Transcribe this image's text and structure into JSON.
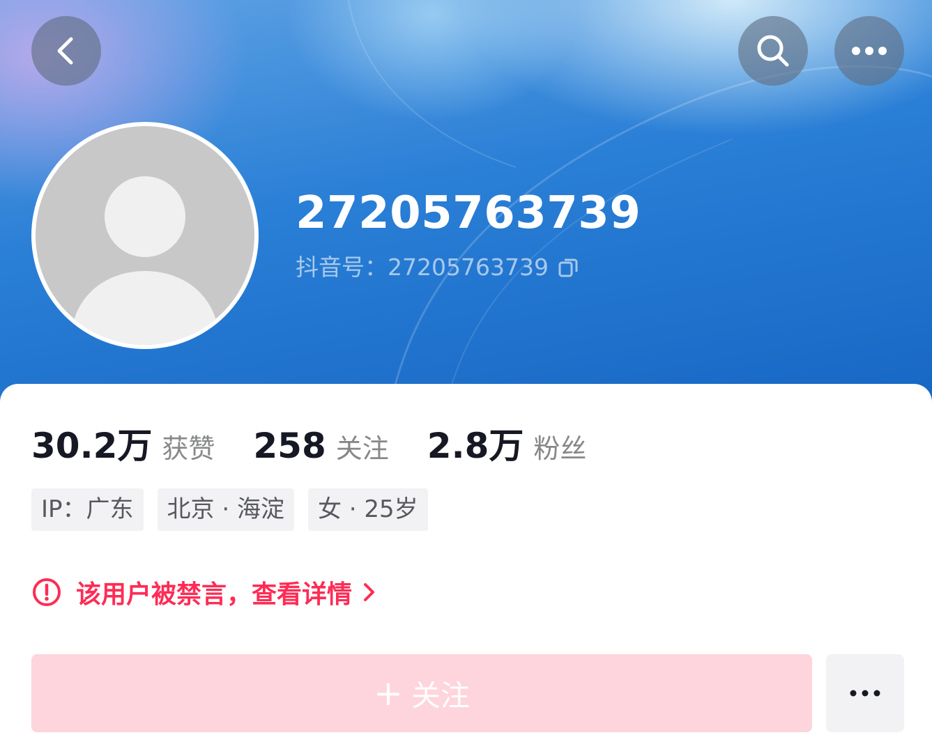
{
  "profile": {
    "nickname": "27205763739",
    "douyin_id_label": "抖音号：",
    "douyin_id": "27205763739"
  },
  "stats": [
    {
      "value": "30.2万",
      "label": "获赞"
    },
    {
      "value": "258",
      "label": "关注"
    },
    {
      "value": "2.8万",
      "label": "粉丝"
    }
  ],
  "tags": [
    "IP：广东",
    "北京 · 海淀",
    "女 · 25岁"
  ],
  "ban_notice": {
    "text": "该用户被禁言，查看详情"
  },
  "follow": {
    "plus": "+",
    "label": "关注"
  },
  "icons": {
    "back": "chevron-left-icon",
    "search": "search-icon",
    "more": "more-horizontal-icon",
    "copy": "copy-icon",
    "warning": "exclamation-circle-icon",
    "chevron": "chevron-right-icon"
  },
  "colors": {
    "accent": "#fe2c55",
    "follow_bg": "#fed5dd",
    "header_blue": "#2a7fd6"
  }
}
